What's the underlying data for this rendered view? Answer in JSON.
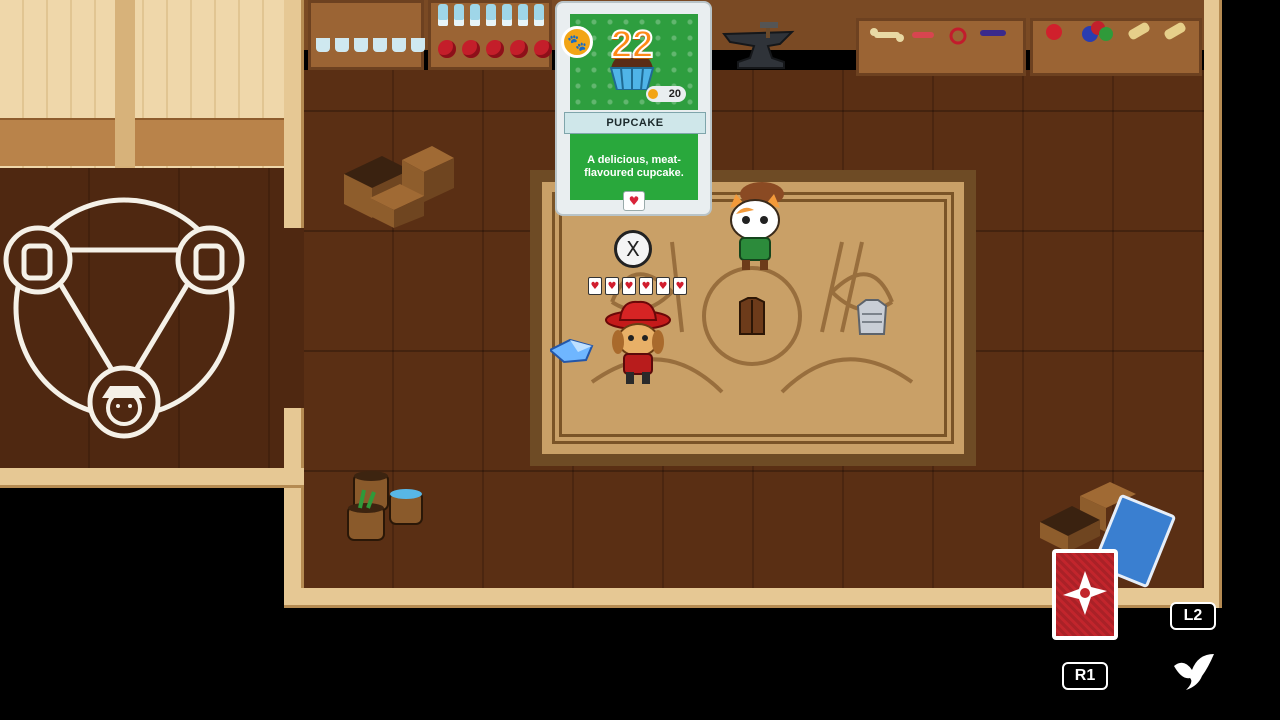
{
  "card": {
    "cost": "22",
    "name": "PUPCAKE",
    "description": "A delicious, meat-flavoured cupcake.",
    "price": "20",
    "coin_icon": "paw-coin-icon",
    "heart_icon": "heart-icon"
  },
  "prompts": {
    "interact": "X",
    "r1": "R1",
    "l2": "L2"
  },
  "player": {
    "health_hearts": 6
  },
  "hud": {
    "ability_icon": "shuriken-icon",
    "dash_icon": "bird-icon",
    "deck_icon": "card-deck-icon"
  },
  "colors": {
    "cost_orange": "#ff8a17",
    "card_green": "#29a83c",
    "ability_red": "#c2252c"
  }
}
